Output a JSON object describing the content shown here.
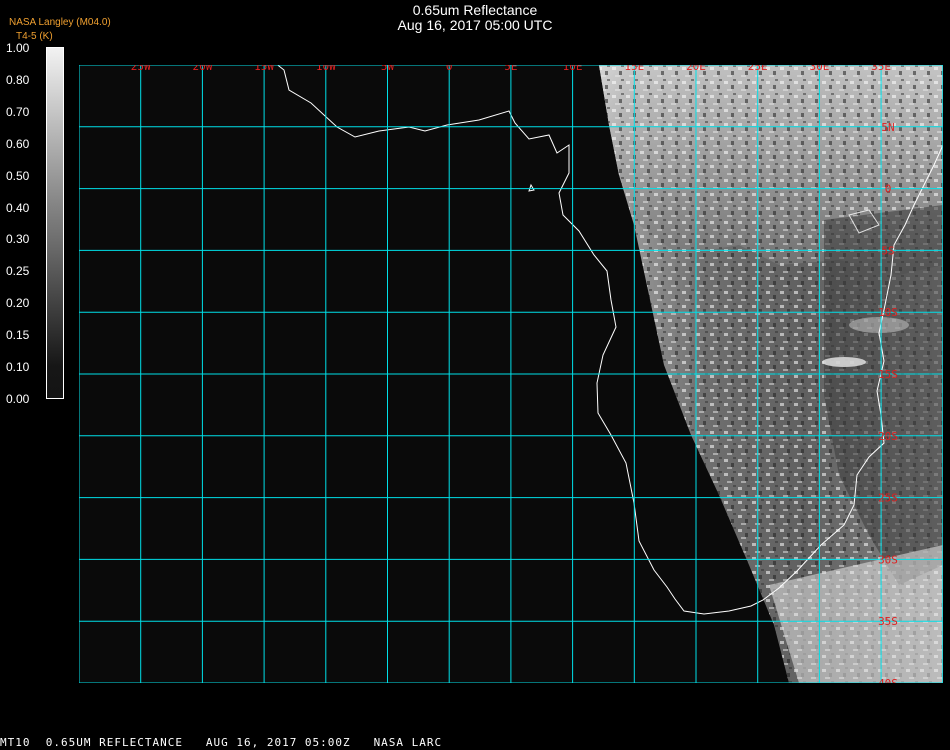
{
  "header": {
    "title": "0.65um Reflectance",
    "subtitle": "Aug 16, 2017 05:00 UTC",
    "credit_line1": "NASA Langley (M04.0)",
    "credit_line2": "T4-5 (K)"
  },
  "colorbar": {
    "labels": [
      "1.00",
      "0.80",
      "0.70",
      "0.60",
      "0.50",
      "0.40",
      "0.30",
      "0.25",
      "0.20",
      "0.15",
      "0.10",
      "0.00"
    ]
  },
  "map": {
    "lon_labels": [
      "25W",
      "20W",
      "15W",
      "10W",
      "5W",
      "0",
      "5E",
      "10E",
      "15E",
      "20E",
      "25E",
      "30E",
      "35E"
    ],
    "lat_labels": [
      "5N",
      "0",
      "5S",
      "10S",
      "15S",
      "20S",
      "25S",
      "30S",
      "35S",
      "40S"
    ],
    "grid_color": "#00e0e8",
    "label_color": "#e02020",
    "coast_color": "#ffffff"
  },
  "footer": {
    "product": "MT10",
    "name": "0.65UM REFLECTANCE",
    "timestamp": "AUG 16, 2017 05:00Z",
    "source": "NASA LARC"
  }
}
